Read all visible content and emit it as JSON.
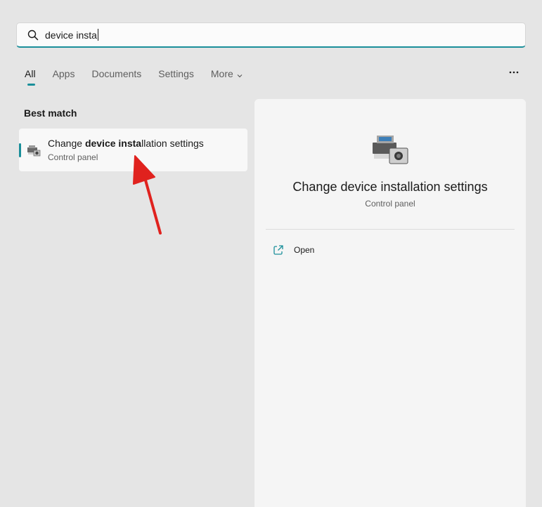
{
  "search": {
    "query": "device insta"
  },
  "tabs": [
    {
      "label": "All"
    },
    {
      "label": "Apps"
    },
    {
      "label": "Documents"
    },
    {
      "label": "Settings"
    },
    {
      "label": "More"
    }
  ],
  "best_match": {
    "heading": "Best match",
    "result": {
      "title_prefix": "Change ",
      "title_bold": "device insta",
      "title_suffix": "llation settings",
      "subtitle": "Control panel"
    }
  },
  "detail": {
    "title": "Change device installation settings",
    "subtitle": "Control panel",
    "actions": [
      {
        "label": "Open",
        "icon": "open-external-icon"
      }
    ]
  },
  "colors": {
    "accent": "#1a8f9a",
    "annotation_arrow": "#e0221e"
  }
}
